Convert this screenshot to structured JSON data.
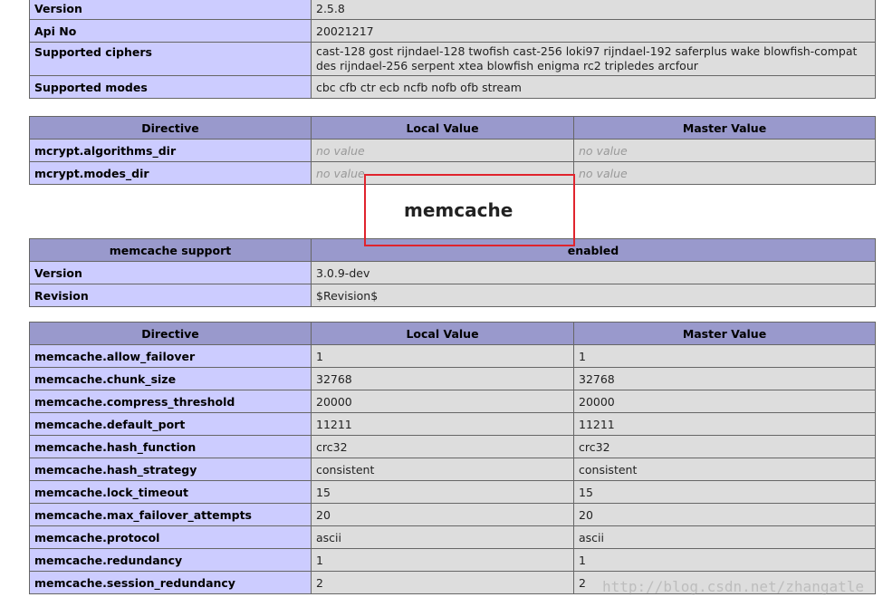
{
  "mcrypt_info": [
    {
      "name": "Version",
      "value": "2.5.8"
    },
    {
      "name": "Api No",
      "value": "20021217"
    },
    {
      "name": "Supported ciphers",
      "value": "cast-128 gost rijndael-128 twofish cast-256 loki97 rijndael-192 saferplus wake blowfish-compat des rijndael-256 serpent xtea blowfish enigma rc2 tripledes arcfour"
    },
    {
      "name": "Supported modes",
      "value": "cbc cfb ctr ecb ncfb nofb ofb stream"
    }
  ],
  "directive_headers": {
    "directive": "Directive",
    "local": "Local Value",
    "master": "Master Value"
  },
  "mcrypt_directives": [
    {
      "name": "mcrypt.algorithms_dir",
      "local": "no value",
      "master": "no value"
    },
    {
      "name": "mcrypt.modes_dir",
      "local": "no value",
      "master": "no value"
    }
  ],
  "section_title": "memcache",
  "memcache_support": {
    "label": "memcache support",
    "value": "enabled"
  },
  "memcache_info": [
    {
      "name": "Version",
      "value": "3.0.9-dev"
    },
    {
      "name": "Revision",
      "value": "$Revision$"
    }
  ],
  "memcache_directives": [
    {
      "name": "memcache.allow_failover",
      "local": "1",
      "master": "1"
    },
    {
      "name": "memcache.chunk_size",
      "local": "32768",
      "master": "32768"
    },
    {
      "name": "memcache.compress_threshold",
      "local": "20000",
      "master": "20000"
    },
    {
      "name": "memcache.default_port",
      "local": "11211",
      "master": "11211"
    },
    {
      "name": "memcache.hash_function",
      "local": "crc32",
      "master": "crc32"
    },
    {
      "name": "memcache.hash_strategy",
      "local": "consistent",
      "master": "consistent"
    },
    {
      "name": "memcache.lock_timeout",
      "local": "15",
      "master": "15"
    },
    {
      "name": "memcache.max_failover_attempts",
      "local": "20",
      "master": "20"
    },
    {
      "name": "memcache.protocol",
      "local": "ascii",
      "master": "ascii"
    },
    {
      "name": "memcache.redundancy",
      "local": "1",
      "master": "1"
    },
    {
      "name": "memcache.session_redundancy",
      "local": "2",
      "master": "2"
    }
  ],
  "watermark": "http://blog.csdn.net/zhangatle",
  "colors": {
    "header": "#9999cc",
    "label_cell": "#ccccff",
    "value_cell": "#dddddd",
    "highlight": "#e0242d"
  }
}
